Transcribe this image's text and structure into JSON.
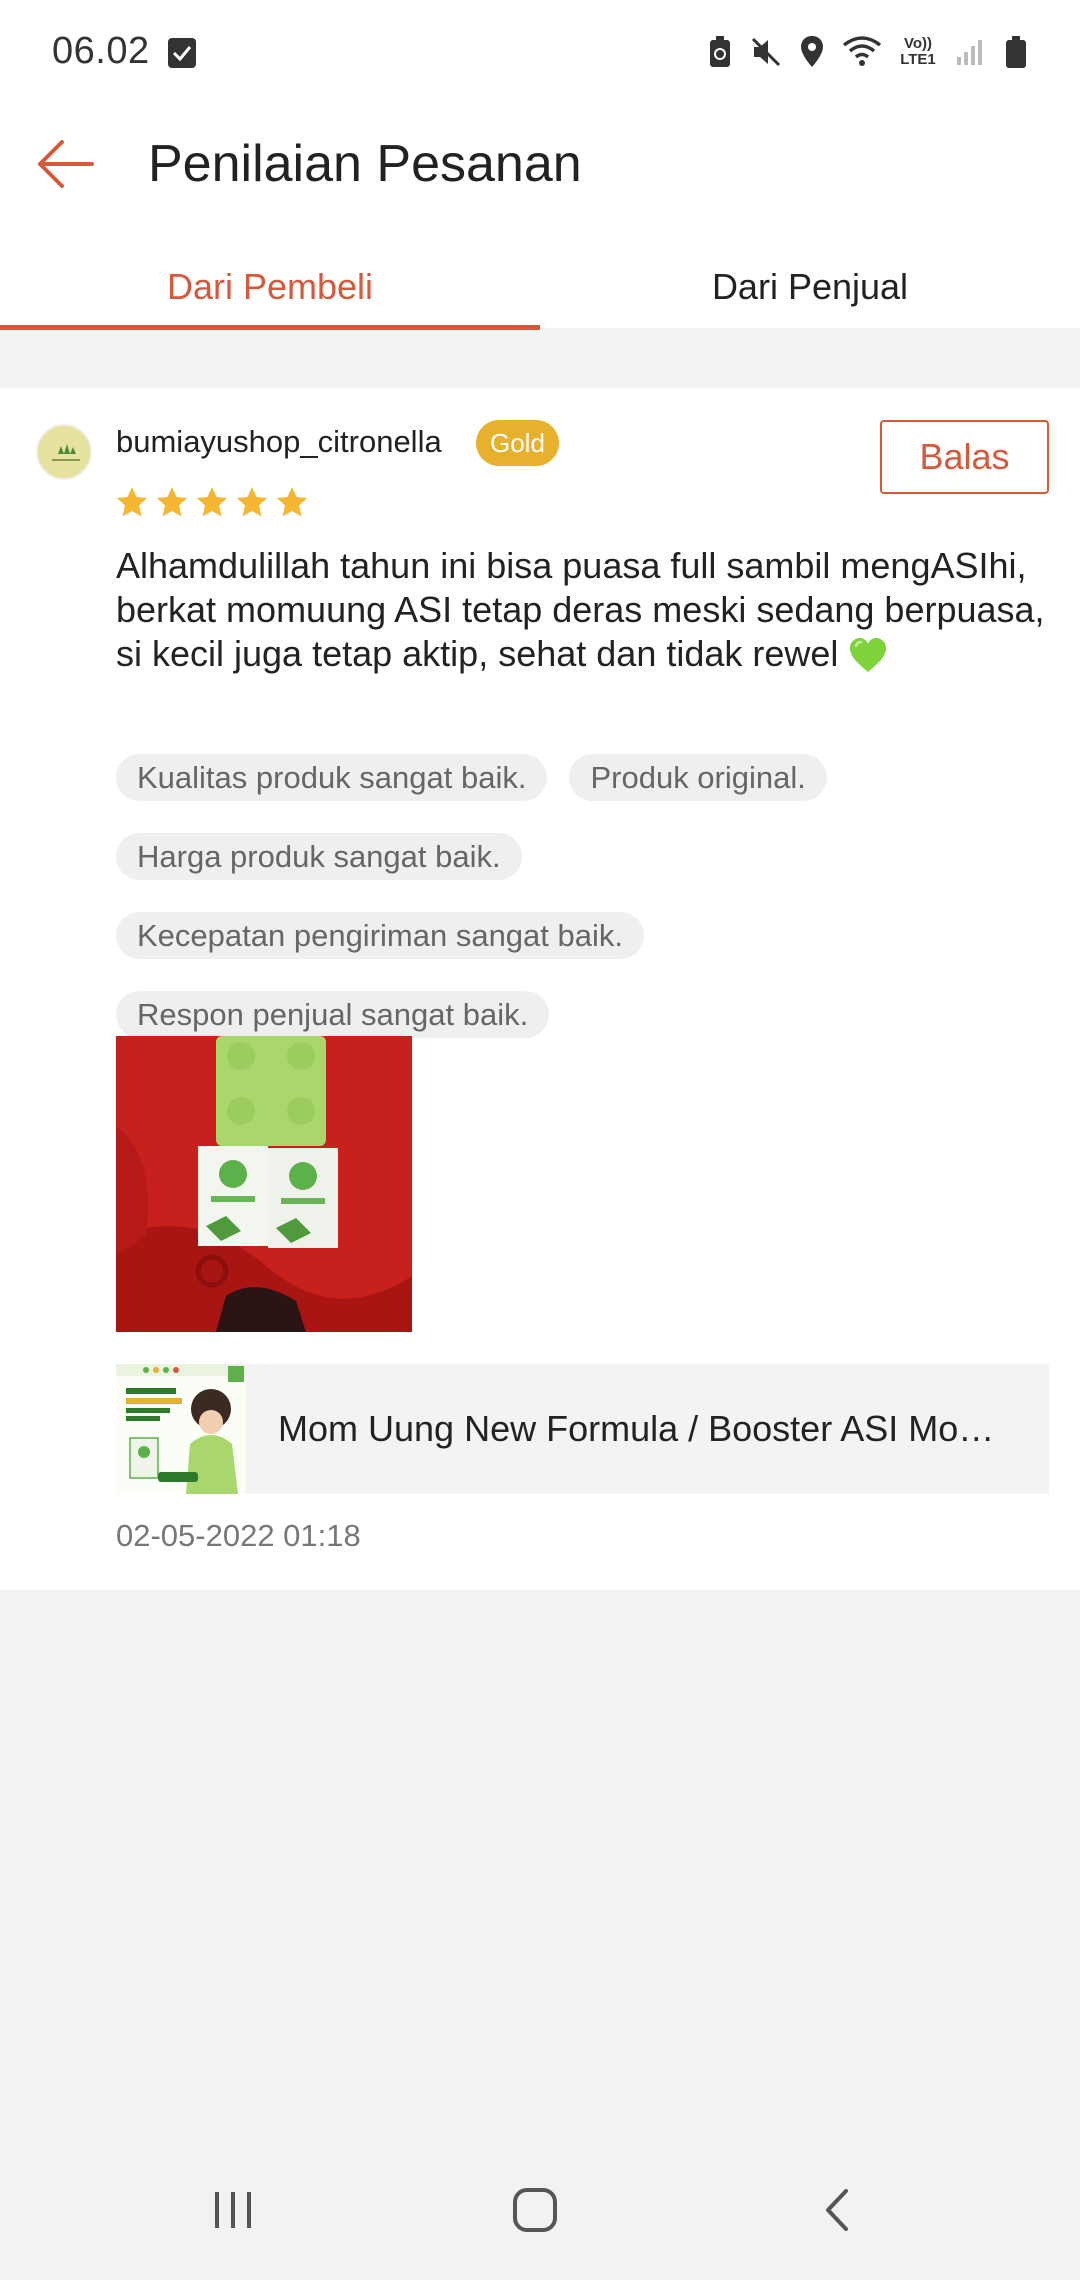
{
  "status_bar": {
    "time": "06.02",
    "network_label_top": "Vo))",
    "network_label_bottom": "LTE1"
  },
  "header": {
    "title": "Penilaian Pesanan"
  },
  "tabs": [
    {
      "label": "Dari Pembeli",
      "active": true
    },
    {
      "label": "Dari Penjual",
      "active": false
    }
  ],
  "review": {
    "username": "bumiayushop_citronella",
    "badge": "Gold",
    "reply_label": "Balas",
    "rating": 5,
    "text": "Alhamdulillah tahun ini bisa puasa full sambil mengASIhi, berkat momuung ASI tetap deras meski sedang berpuasa, si kecil juga tetap aktip, sehat dan tidak rewel",
    "tags": [
      "Kualitas produk sangat baik.",
      "Produk original.",
      "Harga produk sangat baik.",
      "Kecepatan pengiriman sangat baik.",
      "Respon penjual sangat baik."
    ],
    "product_name": "Mom Uung New Formula / Booster ASI Mo…",
    "date": "02-05-2022 01:18"
  },
  "colors": {
    "accent": "#d5593a",
    "gold": "#e7b12e",
    "star": "#f6b632"
  }
}
